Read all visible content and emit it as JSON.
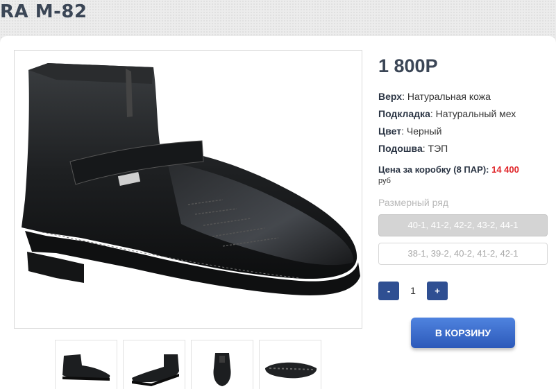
{
  "page": {
    "title": "RA M-82"
  },
  "product": {
    "price": "1 800Р",
    "specs": [
      {
        "key": "Верх",
        "value": "Натуральная кожа"
      },
      {
        "key": "Подкладка",
        "value": "Натуральный мех"
      },
      {
        "key": "Цвет",
        "value": "Черный"
      },
      {
        "key": "Подошва",
        "value": "ТЭП"
      }
    ],
    "box_price": {
      "label": "Цена за коробку (8 ПАР):",
      "value": "14 400",
      "currency": "руб"
    }
  },
  "sizes": {
    "label": "Размерный ряд",
    "options": [
      {
        "text": "40-1, 41-2, 42-2, 43-2, 44-1",
        "selected": true
      },
      {
        "text": "38-1, 39-2, 40-2, 41-2, 42-1",
        "selected": false
      }
    ]
  },
  "quantity": {
    "minus": "-",
    "value": "1",
    "plus": "+"
  },
  "cart": {
    "button_label": "В КОРЗИНУ"
  },
  "colors": {
    "accent": "#2f4f92",
    "price_red": "#e0262a",
    "title": "#3b4656"
  },
  "thumbnails": [
    {
      "icon": "boot-side-view-icon"
    },
    {
      "icon": "boot-angled-view-icon"
    },
    {
      "icon": "boot-front-view-icon"
    },
    {
      "icon": "boot-sole-view-icon"
    }
  ]
}
